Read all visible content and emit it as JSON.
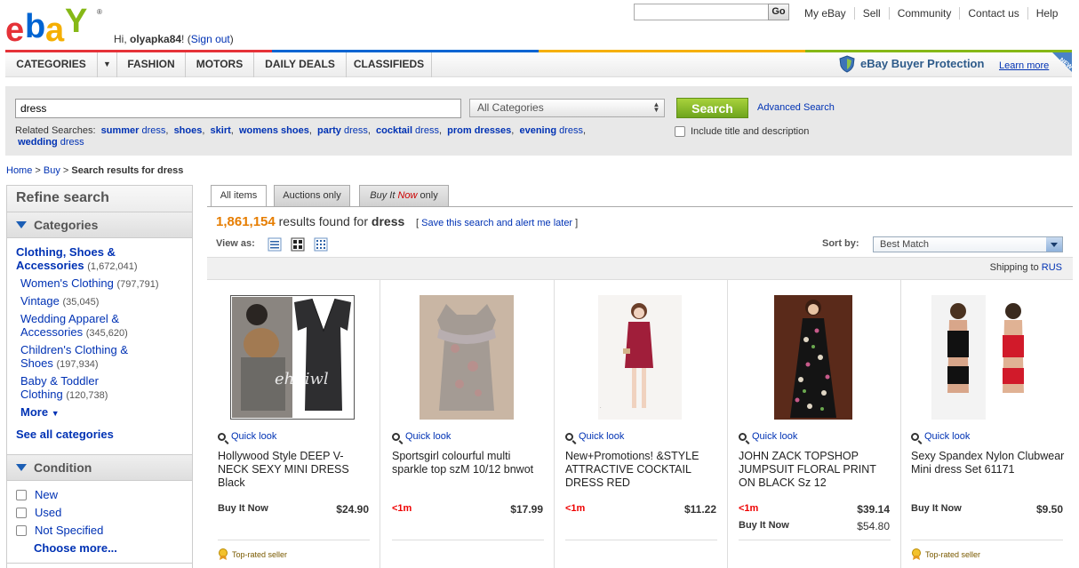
{
  "header": {
    "greeting_prefix": "Hi, ",
    "username": "olyapka84",
    "greeting_sep": "! (",
    "signout": "Sign out",
    "greeting_end": ")",
    "go_label": "Go",
    "top_links": [
      "My eBay",
      "Sell",
      "Community",
      "Contact us",
      "Help"
    ]
  },
  "nav": {
    "items": [
      "CATEGORIES",
      "FASHION",
      "MOTORS",
      "DAILY DEALS",
      "CLASSIFIEDS"
    ],
    "buyer_protection": "eBay Buyer Protection",
    "learn_more": "Learn more",
    "new_badge": "NEW"
  },
  "search": {
    "query": "dress",
    "category": "All Categories",
    "button": "Search",
    "advanced": "Advanced Search",
    "related_label": "Related Searches:",
    "title_desc": "Include title and description"
  },
  "related": [
    {
      "bold": "summer",
      "rest": " dress"
    },
    {
      "bold": "shoes",
      "rest": ""
    },
    {
      "bold": "skirt",
      "rest": ""
    },
    {
      "bold": "womens shoes",
      "rest": ""
    },
    {
      "bold": "party",
      "rest": " dress"
    },
    {
      "bold": "cocktail",
      "rest": " dress"
    },
    {
      "bold": "prom dresses",
      "rest": ""
    },
    {
      "bold": "evening",
      "rest": " dress"
    },
    {
      "bold": "wedding",
      "rest": " dress"
    }
  ],
  "breadcrumb": {
    "home": "Home",
    "sep": " > ",
    "buy": "Buy",
    "current": "Search results for dress"
  },
  "sidebar": {
    "title": "Refine search",
    "categories_head": "Categories",
    "categories": [
      {
        "name": "Clothing, Shoes & Accessories",
        "count": "(1,672,041)"
      },
      {
        "name": "Women's Clothing",
        "count": "(797,791)"
      },
      {
        "name": "Vintage",
        "count": "(35,045)"
      },
      {
        "name": "Wedding Apparel & Accessories",
        "count": "(345,620)"
      },
      {
        "name": "Children's Clothing & Shoes",
        "count": "(197,934)"
      },
      {
        "name": "Baby & Toddler Clothing",
        "count": "(120,738)"
      }
    ],
    "more": "More",
    "see_all": "See all categories",
    "condition_head": "Condition",
    "conditions": [
      "New",
      "Used",
      "Not Specified"
    ],
    "choose_more": "Choose more..."
  },
  "tabs": {
    "all": "All items",
    "auctions": "Auctions only",
    "bin_a": "Buy It ",
    "bin_now": "Now",
    "bin_b": " only"
  },
  "results": {
    "count": "1,861,154",
    "text": " results found for ",
    "query": "dress",
    "save_open": "[ ",
    "save_link": "Save this search and alert me later",
    "save_close": " ]",
    "view_as": "View as:",
    "sort_by": "Sort by:",
    "sort_value": "Best Match",
    "shipping_label": "Shipping to ",
    "shipping_country": "RUS"
  },
  "items": [
    {
      "title": "Hollywood Style DEEP V-NECK SEXY MINI DRESS Black",
      "format": "Buy It Now",
      "price": "$24.90",
      "format2": "",
      "price2": "",
      "top_rated": "Top-rated seller",
      "watermark": "ehdiwl"
    },
    {
      "title": "Sportsgirl colourful multi sparkle top szM 10/12 bnwot",
      "format": "<1m",
      "price": "$17.99",
      "format2": "",
      "price2": "",
      "top_rated": ""
    },
    {
      "title": "New+Promotions! &STYLE ATTRACTIVE COCKTAIL DRESS RED",
      "format": "<1m",
      "price": "$11.22",
      "format2": "",
      "price2": "",
      "top_rated": ""
    },
    {
      "title": "JOHN ZACK TOPSHOP JUMPSUIT FLORAL PRINT ON BLACK Sz 12",
      "format": "<1m",
      "price": "$39.14",
      "format2": "Buy It Now",
      "price2": "$54.80",
      "top_rated": ""
    },
    {
      "title": "Sexy Spandex Nylon Clubwear Mini dress Set 61171",
      "format": "Buy It Now",
      "price": "$9.50",
      "format2": "",
      "price2": "",
      "top_rated": "Top-rated seller"
    }
  ],
  "quick_look": "Quick look",
  "colors": {
    "link": "#0032b4",
    "result_count": "#e67d00",
    "search_button": "#7cb424",
    "time_left": "#ee0000"
  }
}
